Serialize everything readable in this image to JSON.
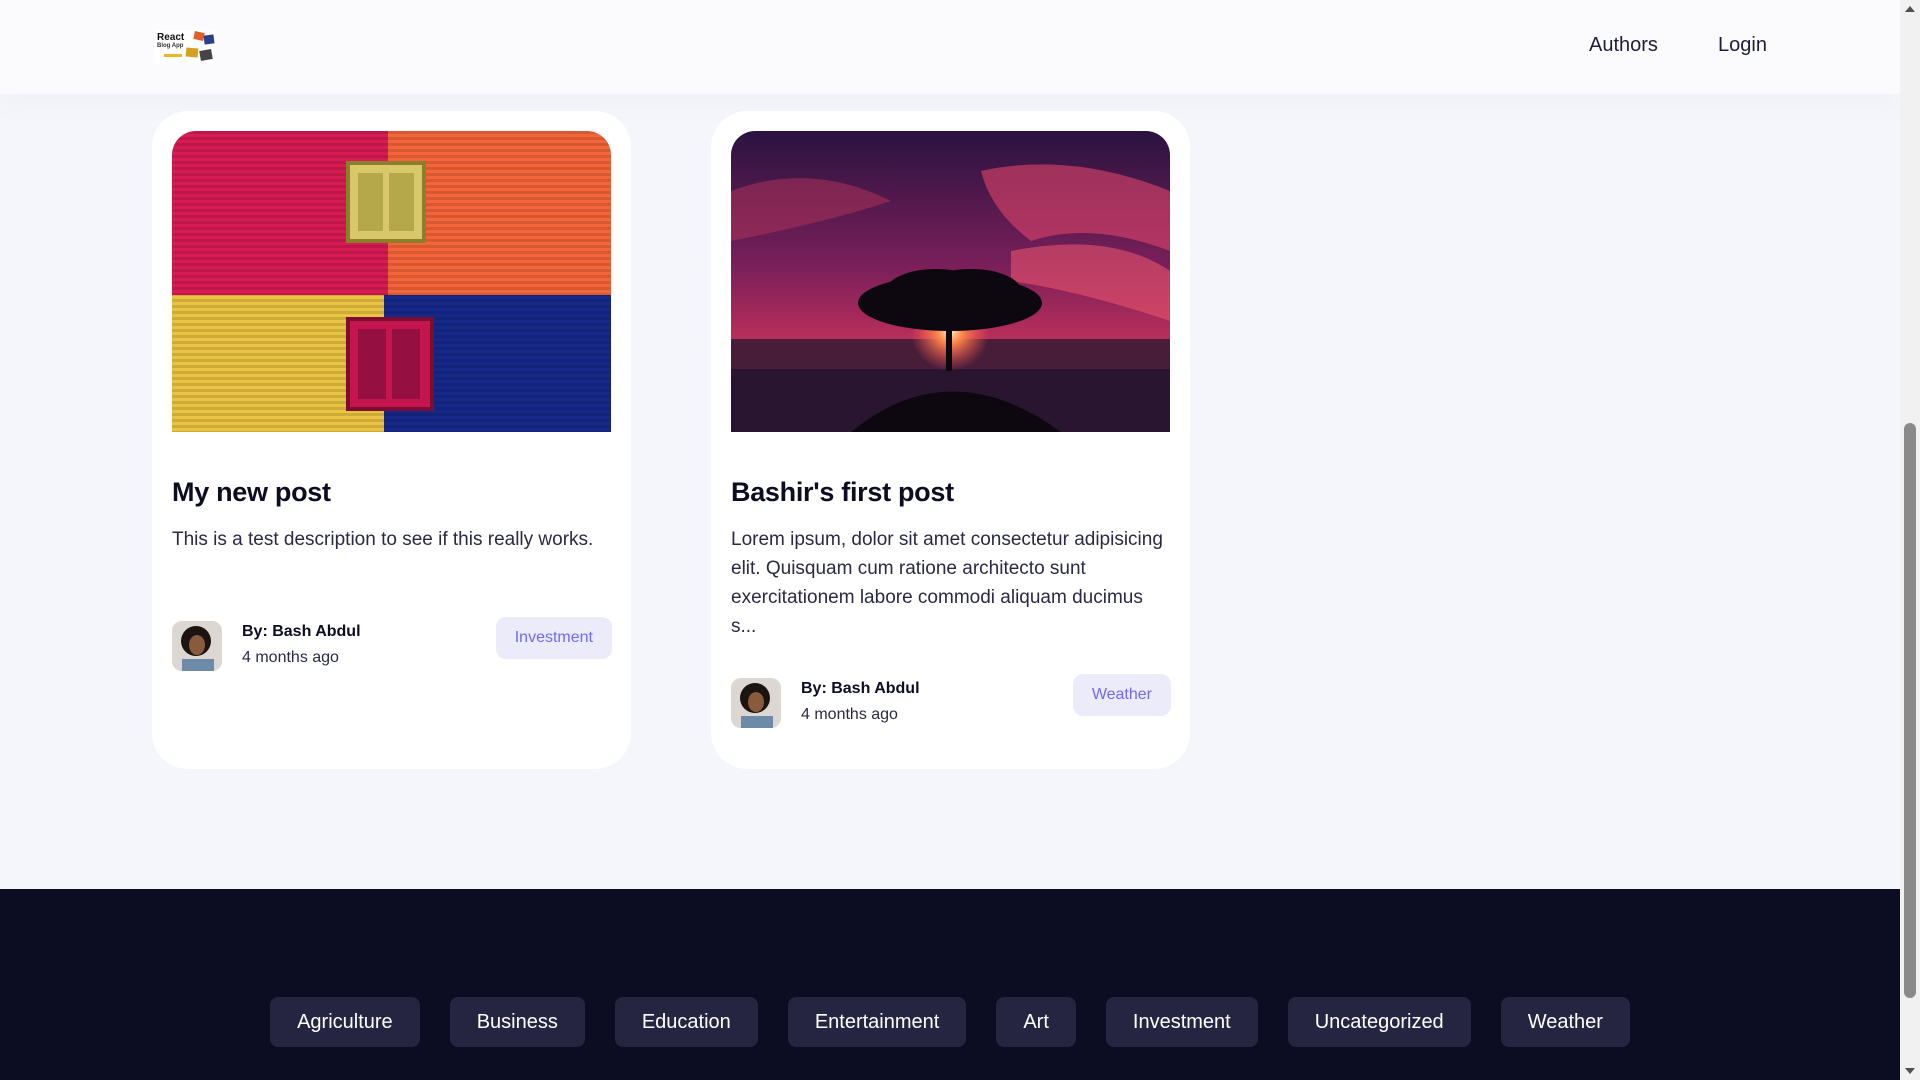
{
  "header": {
    "logo_title": "React",
    "logo_subtitle": "Blog App",
    "links": [
      "Authors",
      "Login"
    ]
  },
  "posts": [
    {
      "title": "My new post",
      "description": "This is a test description to see if this really works.",
      "author": "By: Bash Abdul",
      "time": "4 months ago",
      "category": "Investment",
      "thumbnail": "colorful-wall-windows"
    },
    {
      "title": "Bashir's first post",
      "description": "Lorem ipsum, dolor sit amet consectetur adipisicing elit. Quisquam cum ratione architecto sunt exercitationem labore commodi aliquam ducimus s...",
      "author": "By: Bash Abdul",
      "time": "4 months ago",
      "category": "Weather",
      "thumbnail": "sunset-tree"
    }
  ],
  "footer": {
    "categories": [
      "Agriculture",
      "Business",
      "Education",
      "Entertainment",
      "Art",
      "Investment",
      "Uncategorized",
      "Weather"
    ]
  },
  "colors": {
    "page_bg": "#f5f5fc",
    "footer_bg": "#0c0c22",
    "category_pill_bg": "#252542",
    "tag_bg": "#ecebfa",
    "tag_text": "#6f6af8"
  }
}
